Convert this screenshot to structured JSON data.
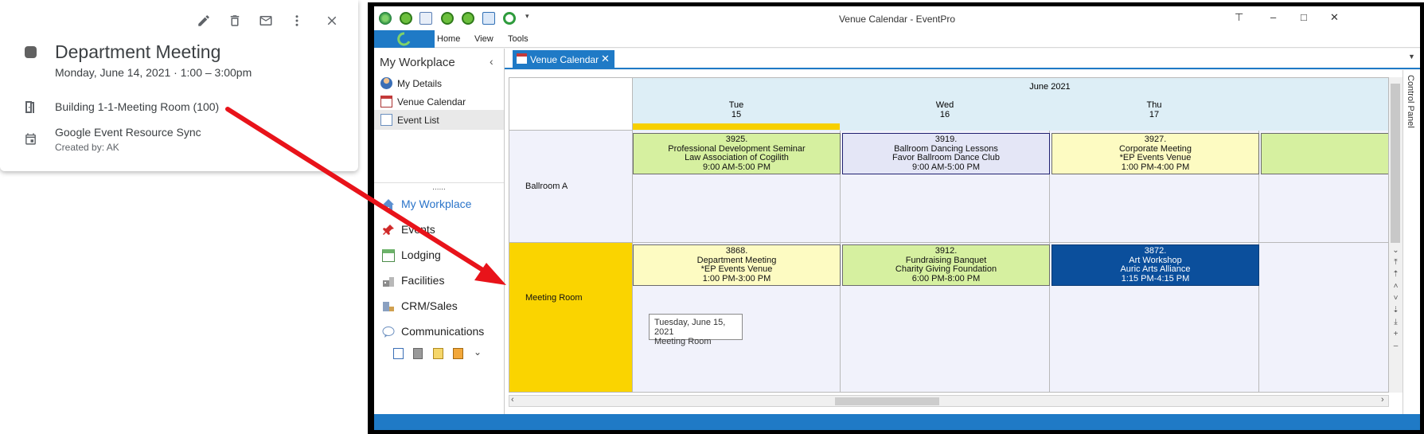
{
  "google_event": {
    "title": "Department Meeting",
    "date_line": "Monday, June 14, 2021  ·  1:00 – 3:00pm",
    "room": "Building 1-1-Meeting Room (100)",
    "calendar": "Google Event Resource Sync",
    "created_by": "Created by: AK",
    "color": "#616161",
    "icons": [
      "edit-icon",
      "delete-icon",
      "email-icon",
      "more-icon",
      "close-icon",
      "room-icon",
      "calendar-icon"
    ]
  },
  "window": {
    "title": "Venue Calendar - EventPro",
    "menu": [
      "Home",
      "View",
      "Tools"
    ]
  },
  "sidebar": {
    "header": "My Workplace",
    "items": [
      {
        "label": "My Details",
        "icon": "person-icon"
      },
      {
        "label": "Venue Calendar",
        "icon": "calendar-icon"
      },
      {
        "label": "Event List",
        "icon": "list-icon"
      }
    ],
    "grip": "......",
    "nav": [
      {
        "label": "My Workplace",
        "icon": "home-icon"
      },
      {
        "label": "Events",
        "icon": "pin-icon"
      },
      {
        "label": "Lodging",
        "icon": "lodging-icon"
      },
      {
        "label": "Facilities",
        "icon": "facilities-icon"
      },
      {
        "label": "CRM/Sales",
        "icon": "crm-icon"
      },
      {
        "label": "Communications",
        "icon": "chat-icon"
      }
    ]
  },
  "tab": {
    "label": "Venue Calendar"
  },
  "calendar": {
    "month": "June 2021",
    "days": [
      {
        "dow": "Tue",
        "num": "15"
      },
      {
        "dow": "Wed",
        "num": "16"
      },
      {
        "dow": "Thu",
        "num": "17"
      }
    ],
    "resources": [
      "Ballroom A",
      "Meeting Room"
    ],
    "events": [
      {
        "id": "3925.",
        "name": "Professional Development Seminar",
        "org": "Law Association of Cogilith",
        "time": "9:00 AM-5:00 PM",
        "color": "#d6f0a0"
      },
      {
        "id": "3919.",
        "name": "Ballroom Dancing Lessons",
        "org": "Favor Ballroom Dance Club",
        "time": "9:00 AM-5:00 PM",
        "color": "#e4e6f6"
      },
      {
        "id": "3927.",
        "name": "Corporate Meeting",
        "org": "*EP Events Venue",
        "time": "1:00 PM-4:00 PM",
        "color": "#fdfbc2"
      },
      {
        "id": "3868.",
        "name": "Department Meeting",
        "org": "*EP Events Venue",
        "time": "1:00 PM-3:00 PM",
        "color": "#fdfbc2"
      },
      {
        "id": "3912.",
        "name": "Fundraising Banquet",
        "org": "Charity Giving Foundation",
        "time": "6:00 PM-8:00 PM",
        "color": "#d6f0a0"
      },
      {
        "id": "3872.",
        "name": "Art Workshop",
        "org": "Auric Arts Alliance",
        "time": "1:15 PM-4:15 PM",
        "color": "#0b4f9c"
      }
    ],
    "tooltip": {
      "line1": "Tuesday, June 15, 2021",
      "line2": "Meeting Room"
    }
  },
  "control_panel": {
    "label": "Control Panel"
  },
  "arrow_color": "#e8131a"
}
